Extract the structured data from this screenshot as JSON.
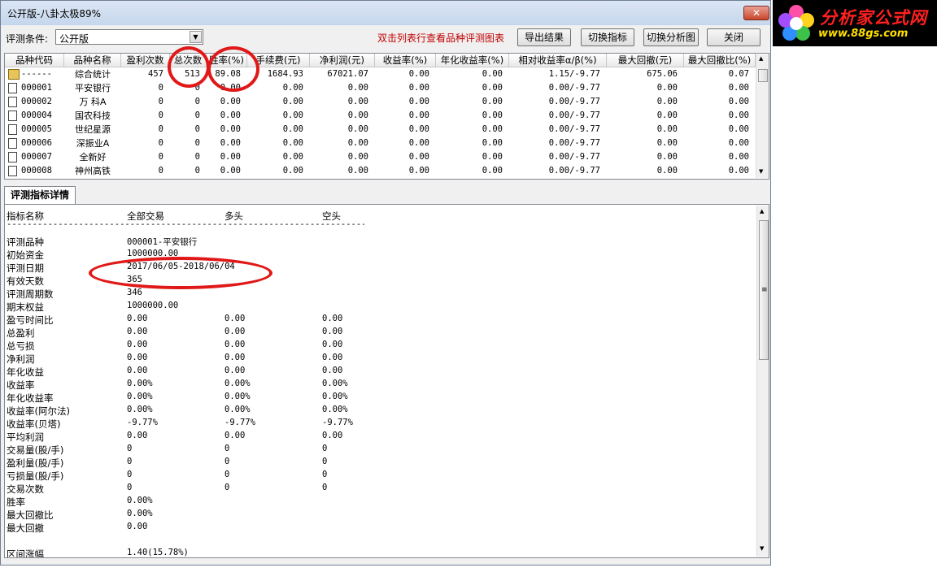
{
  "window": {
    "title": "公开版-八卦太极89%",
    "close_symbol": "✕"
  },
  "toolbar": {
    "condition_label": "评测条件:",
    "condition_value": "公开版",
    "hint": "双击列表行查看品种评测图表",
    "buttons": {
      "export": "导出结果",
      "switch_metric": "切换指标",
      "switch_chart": "切换分析图",
      "close": "关闭"
    }
  },
  "grid": {
    "headers": [
      "品种代码",
      "品种名称",
      "盈利次数",
      "总次数",
      "胜率(%)",
      "手续费(元)",
      "净利润(元)",
      "收益率(%)",
      "年化收益率(%)",
      "相对收益率α/β(%)",
      "最大回撤(元)",
      "最大回撤比(%)"
    ],
    "rows": [
      {
        "icon": "summary-icon",
        "cells": [
          "------",
          "综合统计",
          "457",
          "513",
          "89.08",
          "1684.93",
          "67021.07",
          "0.00",
          "0.00",
          "1.15/-9.77",
          "675.06",
          "0.07"
        ]
      },
      {
        "icon": "file-icon",
        "cells": [
          "000001",
          "平安银行",
          "0",
          "0",
          "0.00",
          "0.00",
          "0.00",
          "0.00",
          "0.00",
          "0.00/-9.77",
          "0.00",
          "0.00"
        ]
      },
      {
        "icon": "file-icon",
        "cells": [
          "000002",
          "万 科A",
          "0",
          "0",
          "0.00",
          "0.00",
          "0.00",
          "0.00",
          "0.00",
          "0.00/-9.77",
          "0.00",
          "0.00"
        ]
      },
      {
        "icon": "file-icon",
        "cells": [
          "000004",
          "国农科技",
          "0",
          "0",
          "0.00",
          "0.00",
          "0.00",
          "0.00",
          "0.00",
          "0.00/-9.77",
          "0.00",
          "0.00"
        ]
      },
      {
        "icon": "file-icon",
        "cells": [
          "000005",
          "世纪星源",
          "0",
          "0",
          "0.00",
          "0.00",
          "0.00",
          "0.00",
          "0.00",
          "0.00/-9.77",
          "0.00",
          "0.00"
        ]
      },
      {
        "icon": "file-icon",
        "cells": [
          "000006",
          "深振业A",
          "0",
          "0",
          "0.00",
          "0.00",
          "0.00",
          "0.00",
          "0.00",
          "0.00/-9.77",
          "0.00",
          "0.00"
        ]
      },
      {
        "icon": "file-icon",
        "cells": [
          "000007",
          "全新好",
          "0",
          "0",
          "0.00",
          "0.00",
          "0.00",
          "0.00",
          "0.00",
          "0.00/-9.77",
          "0.00",
          "0.00"
        ]
      },
      {
        "icon": "file-icon",
        "cells": [
          "000008",
          "神州高铁",
          "0",
          "0",
          "0.00",
          "0.00",
          "0.00",
          "0.00",
          "0.00",
          "0.00/-9.77",
          "0.00",
          "0.00"
        ]
      }
    ]
  },
  "detail": {
    "tab_label": "评测指标详情",
    "columns": [
      "指标名称",
      "全部交易",
      "多头",
      "空头"
    ],
    "divider": "------------------------------------------------------------------------------------------------------------",
    "rows": [
      [
        "评测品种",
        "000001-平安银行",
        "",
        ""
      ],
      [
        "初始资金",
        "1000000.00",
        "",
        ""
      ],
      [
        "评测日期",
        "2017/06/05-2018/06/04",
        "",
        ""
      ],
      [
        "有效天数",
        "365",
        "",
        ""
      ],
      [
        "评测周期数",
        "346",
        "",
        ""
      ],
      [
        "期末权益",
        "1000000.00",
        "",
        ""
      ],
      [
        "盈亏时间比",
        "0.00",
        "0.00",
        "0.00"
      ],
      [
        "总盈利",
        "0.00",
        "0.00",
        "0.00"
      ],
      [
        "总亏损",
        "0.00",
        "0.00",
        "0.00"
      ],
      [
        "净利润",
        "0.00",
        "0.00",
        "0.00"
      ],
      [
        "年化收益",
        "0.00",
        "0.00",
        "0.00"
      ],
      [
        "收益率",
        "0.00%",
        "0.00%",
        "0.00%"
      ],
      [
        "年化收益率",
        "0.00%",
        "0.00%",
        "0.00%"
      ],
      [
        "收益率(阿尔法)",
        "0.00%",
        "0.00%",
        "0.00%"
      ],
      [
        "收益率(贝塔)",
        "-9.77%",
        "-9.77%",
        "-9.77%"
      ],
      [
        "平均利润",
        "0.00",
        "0.00",
        "0.00"
      ],
      [
        "交易量(股/手)",
        "0",
        "0",
        "0"
      ],
      [
        "盈利量(股/手)",
        "0",
        "0",
        "0"
      ],
      [
        "亏损量(股/手)",
        "0",
        "0",
        "0"
      ],
      [
        "交易次数",
        "0",
        "0",
        "0"
      ],
      [
        "胜率",
        "0.00%",
        "",
        ""
      ],
      [
        "最大回撤比",
        "0.00%",
        "",
        ""
      ],
      [
        "最大回撤",
        "0.00",
        "",
        ""
      ],
      [
        "",
        "",
        "",
        ""
      ],
      [
        "区间涨幅",
        "1.40(15.78%)",
        "",
        ""
      ]
    ]
  },
  "logo": {
    "name": "分析家公式网",
    "url": "www.88gs.com"
  },
  "colors": {
    "annotation_red": "#e01818",
    "hint_red": "#c00000",
    "logo_bg": "#000000"
  }
}
